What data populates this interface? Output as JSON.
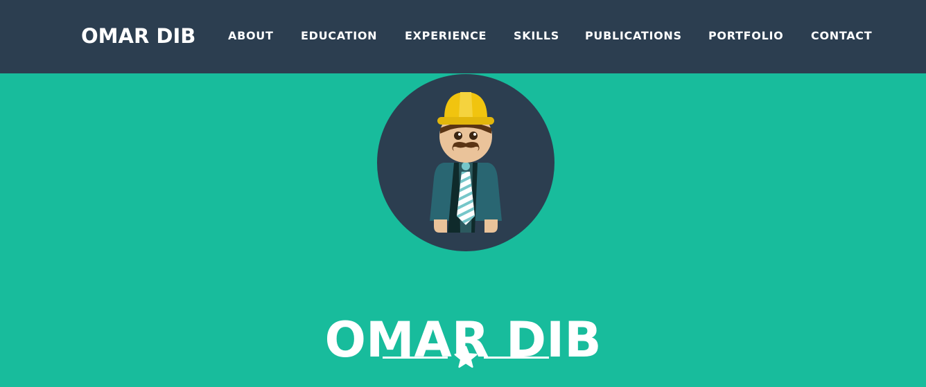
{
  "nav": {
    "brand": "OMAR DIB",
    "items": [
      {
        "label": "ABOUT"
      },
      {
        "label": "EDUCATION"
      },
      {
        "label": "EXPERIENCE"
      },
      {
        "label": "SKILLS"
      },
      {
        "label": "PUBLICATIONS"
      },
      {
        "label": "PORTFOLIO"
      },
      {
        "label": "CONTACT"
      }
    ]
  },
  "hero": {
    "title": "OMAR DIB",
    "avatar_icon": "engineer-avatar-icon",
    "divider_icon": "star-icon"
  },
  "colors": {
    "navbar": "#2c3e50",
    "hero_background": "#18bc9c",
    "text": "#ffffff",
    "hard_hat": "#f1c40f"
  }
}
